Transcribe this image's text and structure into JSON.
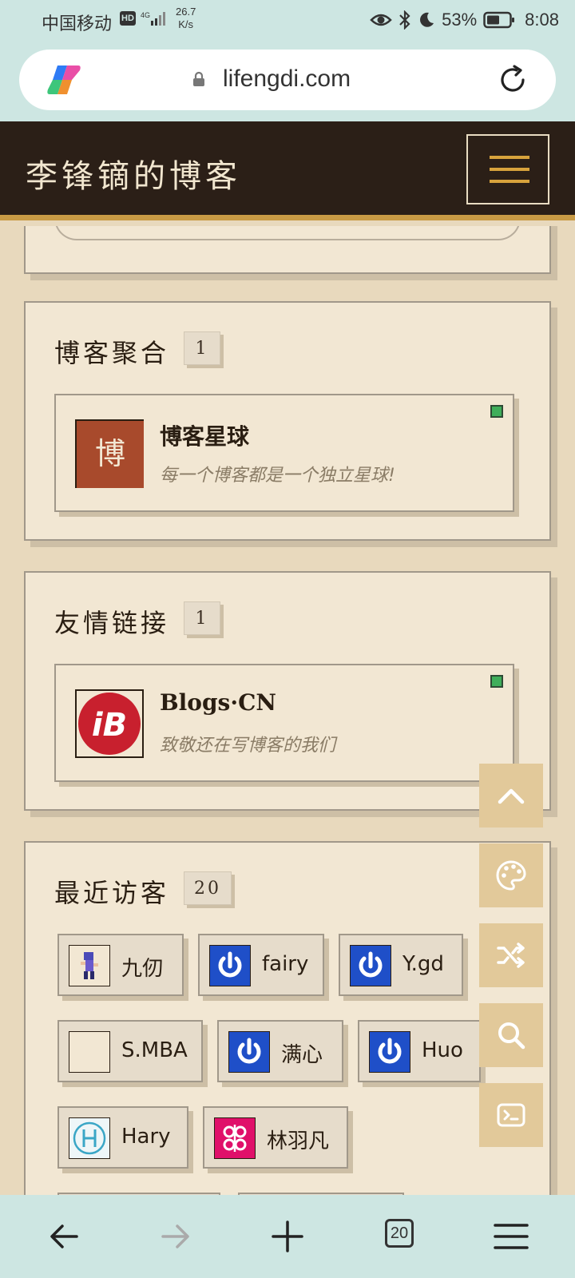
{
  "status_bar": {
    "carrier": "中国移动",
    "hd": "HD",
    "network": "4G",
    "speed_value": "26.7",
    "speed_unit": "K/s",
    "battery": "53%",
    "time": "8:08"
  },
  "browser": {
    "url": "lifengdi.com",
    "tabs_count": "20"
  },
  "site": {
    "title": "李锋镝的博客"
  },
  "sections": {
    "blog_aggregation": {
      "title": "博客聚合",
      "count": "1",
      "item": {
        "avatar_char": "博",
        "name": "博客星球",
        "desc": "每一个博客都是一个独立星球!"
      }
    },
    "friend_links": {
      "title": "友情链接",
      "count": "1",
      "item": {
        "avatar_text": "iB",
        "name": "Blogs·CN",
        "desc": "致敬还在写博客的我们"
      }
    },
    "recent_visitors": {
      "title": "最近访客",
      "count": "20",
      "visitors": [
        {
          "name": "九仞"
        },
        {
          "name": "fairy"
        },
        {
          "name": "Y.gd"
        },
        {
          "name": "S.MBA"
        },
        {
          "name": "满心"
        },
        {
          "name": "Huo"
        },
        {
          "name": "Hary"
        },
        {
          "name": "林羽凡"
        }
      ]
    }
  },
  "colors": {
    "header_bg": "#2b1f17",
    "accent_gold": "#c99b45",
    "card_bg": "#f2e7d3",
    "page_bg": "#e8d9bd",
    "online_green": "#3fae5a",
    "fab_bg": "#e2c99a"
  },
  "icons": {
    "fabs": [
      "arrow-up-icon",
      "palette-icon",
      "shuffle-icon",
      "search-icon",
      "terminal-icon"
    ],
    "nav": [
      "back-arrow-icon",
      "forward-arrow-icon",
      "plus-icon",
      "tabs-icon",
      "menu-icon"
    ]
  }
}
